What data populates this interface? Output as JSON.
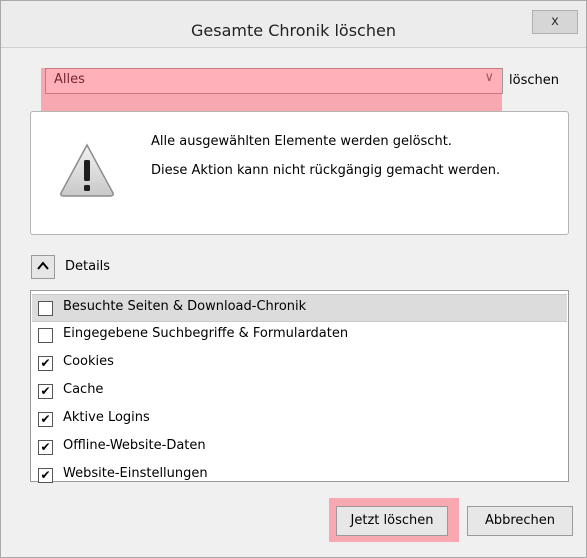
{
  "window": {
    "title": "Gesamte Chronik löschen",
    "close_label": "x"
  },
  "range": {
    "selected": "Alles",
    "suffix": "löschen",
    "chevron": "chevron-down-icon"
  },
  "warning": {
    "icon": "warning-icon",
    "line1": "Alle ausgewählten Elemente werden gelöscht.",
    "line2": "Diese Aktion kann nicht rückgängig gemacht werden."
  },
  "details": {
    "toggle_glyph": "^",
    "label": "Details"
  },
  "items": [
    {
      "label": "Besuchte Seiten & Download-Chronik",
      "checked": false,
      "selected": true
    },
    {
      "label": "Eingegebene Suchbegriffe & Formulardaten",
      "checked": false,
      "selected": false
    },
    {
      "label": "Cookies",
      "checked": true,
      "selected": false
    },
    {
      "label": "Cache",
      "checked": true,
      "selected": false
    },
    {
      "label": "Aktive Logins",
      "checked": true,
      "selected": false
    },
    {
      "label": "Offline-Website-Daten",
      "checked": true,
      "selected": false
    },
    {
      "label": "Website-Einstellungen",
      "checked": true,
      "selected": false
    }
  ],
  "buttons": {
    "clear": "Jetzt löschen",
    "cancel": "Abbrechen"
  },
  "colors": {
    "highlight": "#ff5064",
    "selected_row": "#dcdcdc"
  }
}
